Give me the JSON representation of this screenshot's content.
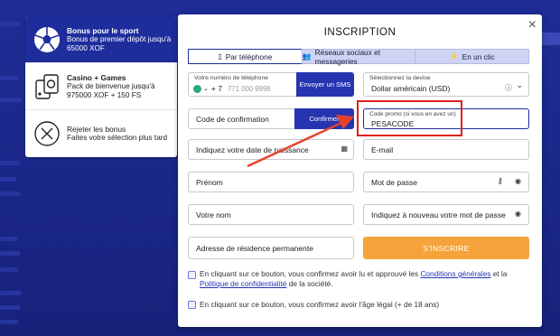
{
  "bonus_panel": {
    "items": [
      {
        "title": "Bonus pour le sport",
        "desc": "Bonus de premier dépôt jusqu'à 65000 XOF",
        "icon": "soccer-ball-icon",
        "active": true
      },
      {
        "title": "Casino + Games",
        "desc": "Pack de bienvenue jusqu'à 975000 XOF + 150 FS",
        "icon": "casino-chip-icon",
        "active": false
      },
      {
        "title": "Rejeter les bonus",
        "desc": "Faites votre sélection plus tard",
        "icon": "close-circle-icon",
        "active": false
      }
    ]
  },
  "modal": {
    "title": "INSCRIPTION",
    "close": "×",
    "tabs": [
      {
        "label": "Par téléphone",
        "icon": "phone-icon",
        "active": true
      },
      {
        "label": "Réseaux sociaux et messageries",
        "icon": "users-icon",
        "active": false
      },
      {
        "label": "En un clic",
        "icon": "lightning-icon",
        "active": false
      }
    ],
    "phone": {
      "label": "Votre numéro de téléphone",
      "code": "+ 7",
      "placeholder": "771 000 9998",
      "sms_button": "Envoyer un SMS"
    },
    "currency": {
      "label": "Sélectionnez la devise",
      "value": "Dollar américain (USD)"
    },
    "confirmation": {
      "placeholder": "Code de confirmation",
      "button": "Confirmer"
    },
    "promo": {
      "label": "Code promo (si vous en avez un)",
      "value": "PESACODE"
    },
    "birthdate": {
      "placeholder": "Indiquez votre date de naissance"
    },
    "email": {
      "placeholder": "E-mail"
    },
    "first_name": {
      "placeholder": "Prénom"
    },
    "password": {
      "placeholder": "Mot de passe"
    },
    "last_name": {
      "placeholder": "Votre nom"
    },
    "password_repeat": {
      "placeholder": "Indiquez à nouveau votre mot de passe"
    },
    "address": {
      "placeholder": "Adresse de résidence permanente"
    },
    "submit": "S'INSCRIRE",
    "terms": {
      "prefix": "En cliquant sur ce bouton, vous confirmez avoir lu et approuvé les ",
      "link1": "Conditions générales",
      "mid": " et la ",
      "link2": "Politique de confidentialité",
      "suffix": " de la société."
    },
    "age": "En cliquant sur ce bouton, vous confirmez avoir l'âge légal (+ de 18 ans)"
  },
  "colors": {
    "accent": "#2634b0",
    "submit": "#f5a33a",
    "highlight": "#e11f1f",
    "arrow": "#e8412a"
  }
}
